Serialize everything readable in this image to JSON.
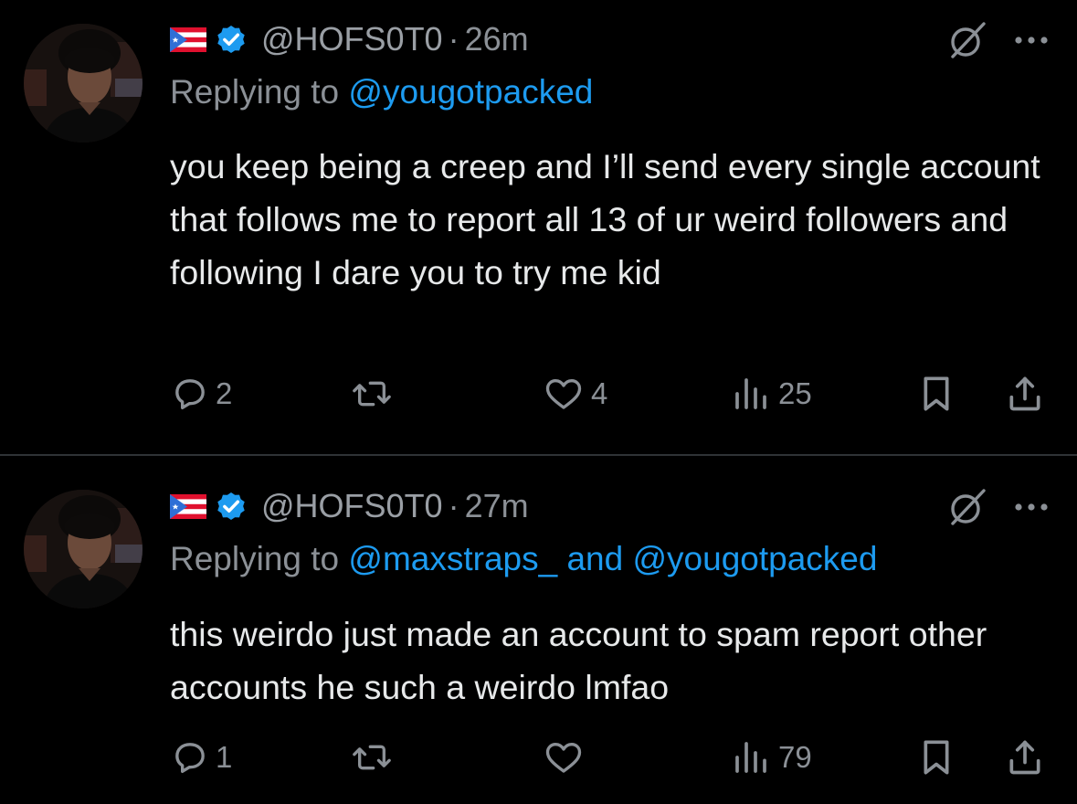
{
  "tweets": [
    {
      "handle": "@HOFS0T0",
      "separator": "·",
      "time": "26m",
      "replying_prefix": "Replying to ",
      "mentions": [
        "@yougotpacked"
      ],
      "mention_joiner": "",
      "text": "you keep being a creep and I’ll send every single account that follows me to report all 13 of ur weird followers and following I dare you to try me kid",
      "replies": "2",
      "retweets": "",
      "likes": "4",
      "views": "25"
    },
    {
      "handle": "@HOFS0T0",
      "separator": "·",
      "time": "27m",
      "replying_prefix": "Replying to ",
      "mentions": [
        "@maxstraps_",
        "@yougotpacked"
      ],
      "mention_joiner": " and ",
      "text": "this weirdo just made an account to spam report other accounts he such a weirdo lmfao",
      "replies": "1",
      "retweets": "",
      "likes": "",
      "views": "79"
    }
  ],
  "icons": {
    "flag": "puerto-rico-flag-icon",
    "verified": "verified-badge-icon",
    "grok": "grok-icon",
    "more": "more-icon",
    "reply": "reply-icon",
    "retweet": "retweet-icon",
    "like": "like-icon",
    "views": "views-icon",
    "bookmark": "bookmark-icon",
    "share": "share-icon"
  },
  "colors": {
    "background": "#000000",
    "text": "#e7e9ea",
    "muted": "#8b9096",
    "link": "#1d9bf0",
    "verified": "#1d9bf0",
    "divider": "#2f3336"
  }
}
